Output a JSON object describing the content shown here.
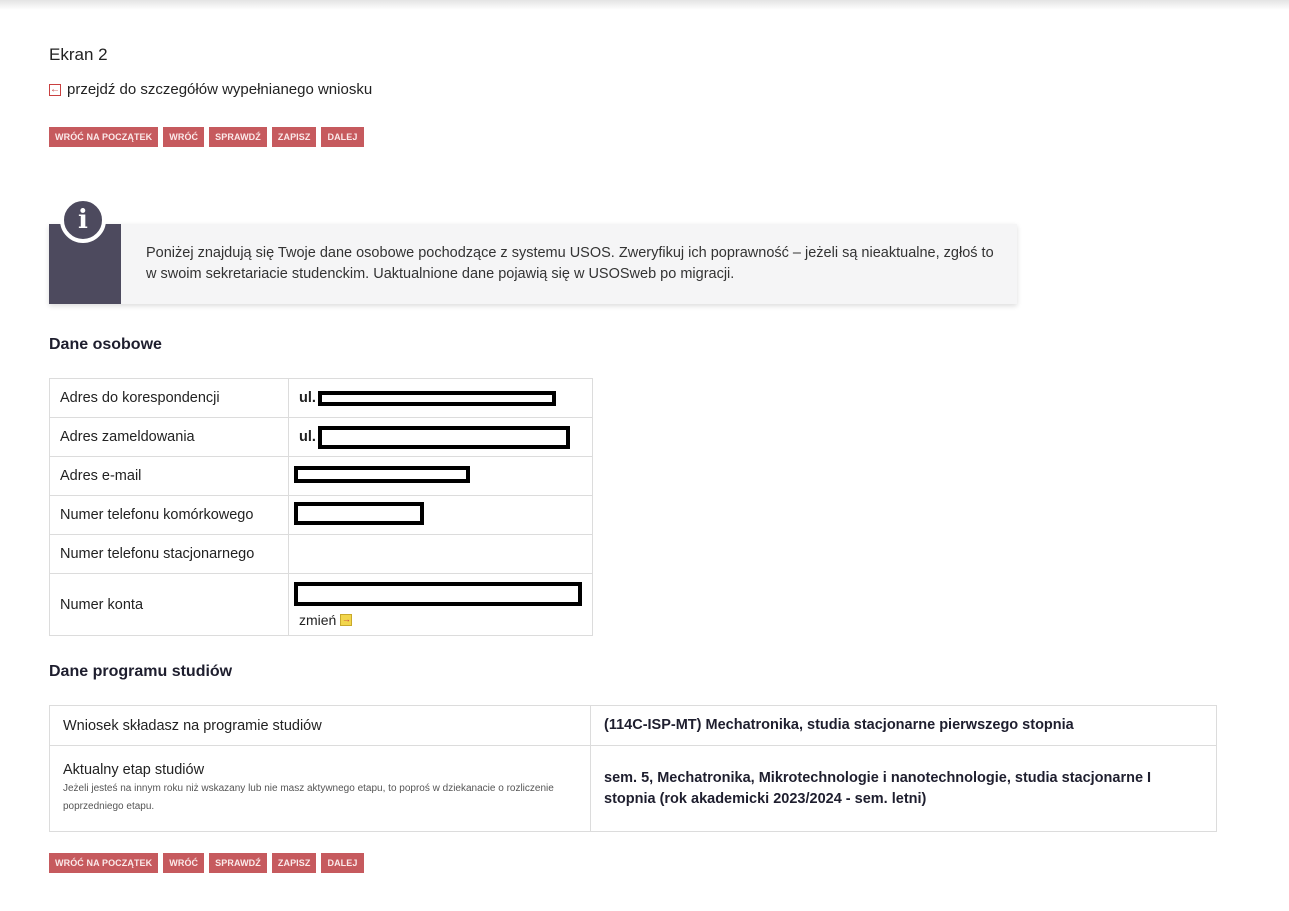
{
  "screen_title": "Ekran 2",
  "details_link": {
    "icon": "arrow-left-icon",
    "label": "przejdź do szczegółów wypełnianego wniosku"
  },
  "buttons": {
    "back_to_start": "WRÓĆ NA POCZĄTEK",
    "back": "WRÓĆ",
    "check": "SPRAWDŹ",
    "save": "ZAPISZ",
    "next": "DALEJ"
  },
  "info": {
    "icon": "info-icon",
    "text": "Poniżej znajdują się Twoje dane osobowe pochodzące z systemu USOS. Zweryfikuj ich poprawność – jeżeli są nieaktualne, zgłoś to w swoim sekretariacie studenckim. Uaktualnione dane pojawią się w USOSweb po migracji."
  },
  "personal": {
    "title": "Dane osobowe",
    "rows": [
      {
        "label": "Adres do korespondencji",
        "prefix": "ul."
      },
      {
        "label": "Adres zameldowania",
        "prefix": "ul."
      },
      {
        "label": "Adres e-mail"
      },
      {
        "label": "Numer telefonu komórkowego"
      },
      {
        "label": "Numer telefonu stacjonarnego"
      },
      {
        "label": "Numer konta",
        "change_label": "zmień"
      }
    ]
  },
  "program": {
    "title": "Dane programu studiów",
    "rows": [
      {
        "label": "Wniosek składasz na programie studiów",
        "value": "(114C-ISP-MT) Mechatronika, studia stacjonarne pierwszego stopnia"
      },
      {
        "label": "Aktualny etap studiów",
        "note": "Jeżeli jesteś na innym roku niż wskazany lub nie masz aktywnego etapu, to poproś w dziekanacie o rozliczenie poprzedniego etapu.",
        "value": "sem. 5, Mechatronika, Mikrotechnologie i nanotechnologie, studia stacjonarne I stopnia (rok akademicki 2023/2024 - sem. letni)"
      }
    ]
  }
}
